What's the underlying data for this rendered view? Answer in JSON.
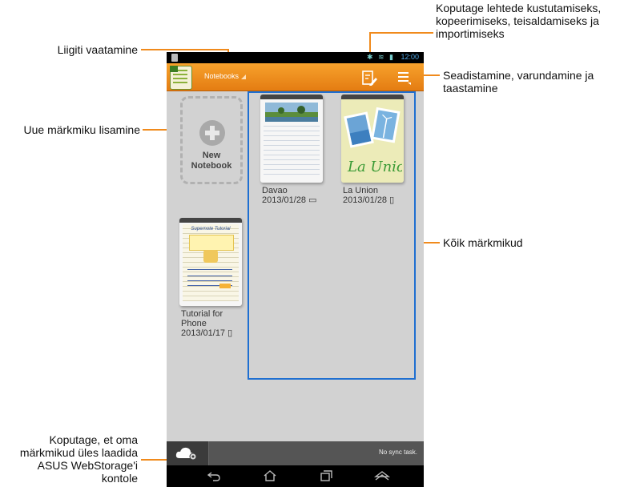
{
  "callouts": {
    "view_category": "Liigiti vaatamine",
    "add_notebook": "Uue märkmiku lisamine",
    "edit_pages": [
      "Koputage lehtede kustutamiseks,",
      "kopeerimiseks, teisaldamiseks ja",
      "importimiseks"
    ],
    "settings": [
      "Seadistamine, varundamine ja",
      "taastamine"
    ],
    "all_notebooks": "Kõik märkmikud",
    "upload": [
      "Koputage, et oma",
      "märkmikud üles laadida",
      "ASUS WebStorage'i",
      "kontole"
    ]
  },
  "status_bar": {
    "time": "12:00"
  },
  "action_bar": {
    "view_dropdown": "Notebooks"
  },
  "new_notebook": {
    "line1": "New",
    "line2": "Notebook"
  },
  "notebooks": [
    {
      "title": "Davao",
      "date": "2013/01/28"
    },
    {
      "title": "La Union",
      "date": "2013/01/28",
      "cover_text": "La Union"
    },
    {
      "title_line1": "Tutorial for",
      "title_line2": "Phone",
      "date": "2013/01/17",
      "cover_title": "Supernote Tutorial"
    }
  ],
  "bottom_bar": {
    "sync_status": "No sync task."
  },
  "icons": {
    "edit_pages": "edit-pages-icon",
    "menu": "menu-icon",
    "cloud": "cloud-settings-icon",
    "back": "back-icon",
    "home": "home-icon",
    "recents": "recents-icon",
    "hide": "hide-keyboard-icon"
  },
  "colors": {
    "accent": "#f08a1c",
    "action_bar": "#e8891a",
    "marker_dot": "#1f6fd1"
  }
}
